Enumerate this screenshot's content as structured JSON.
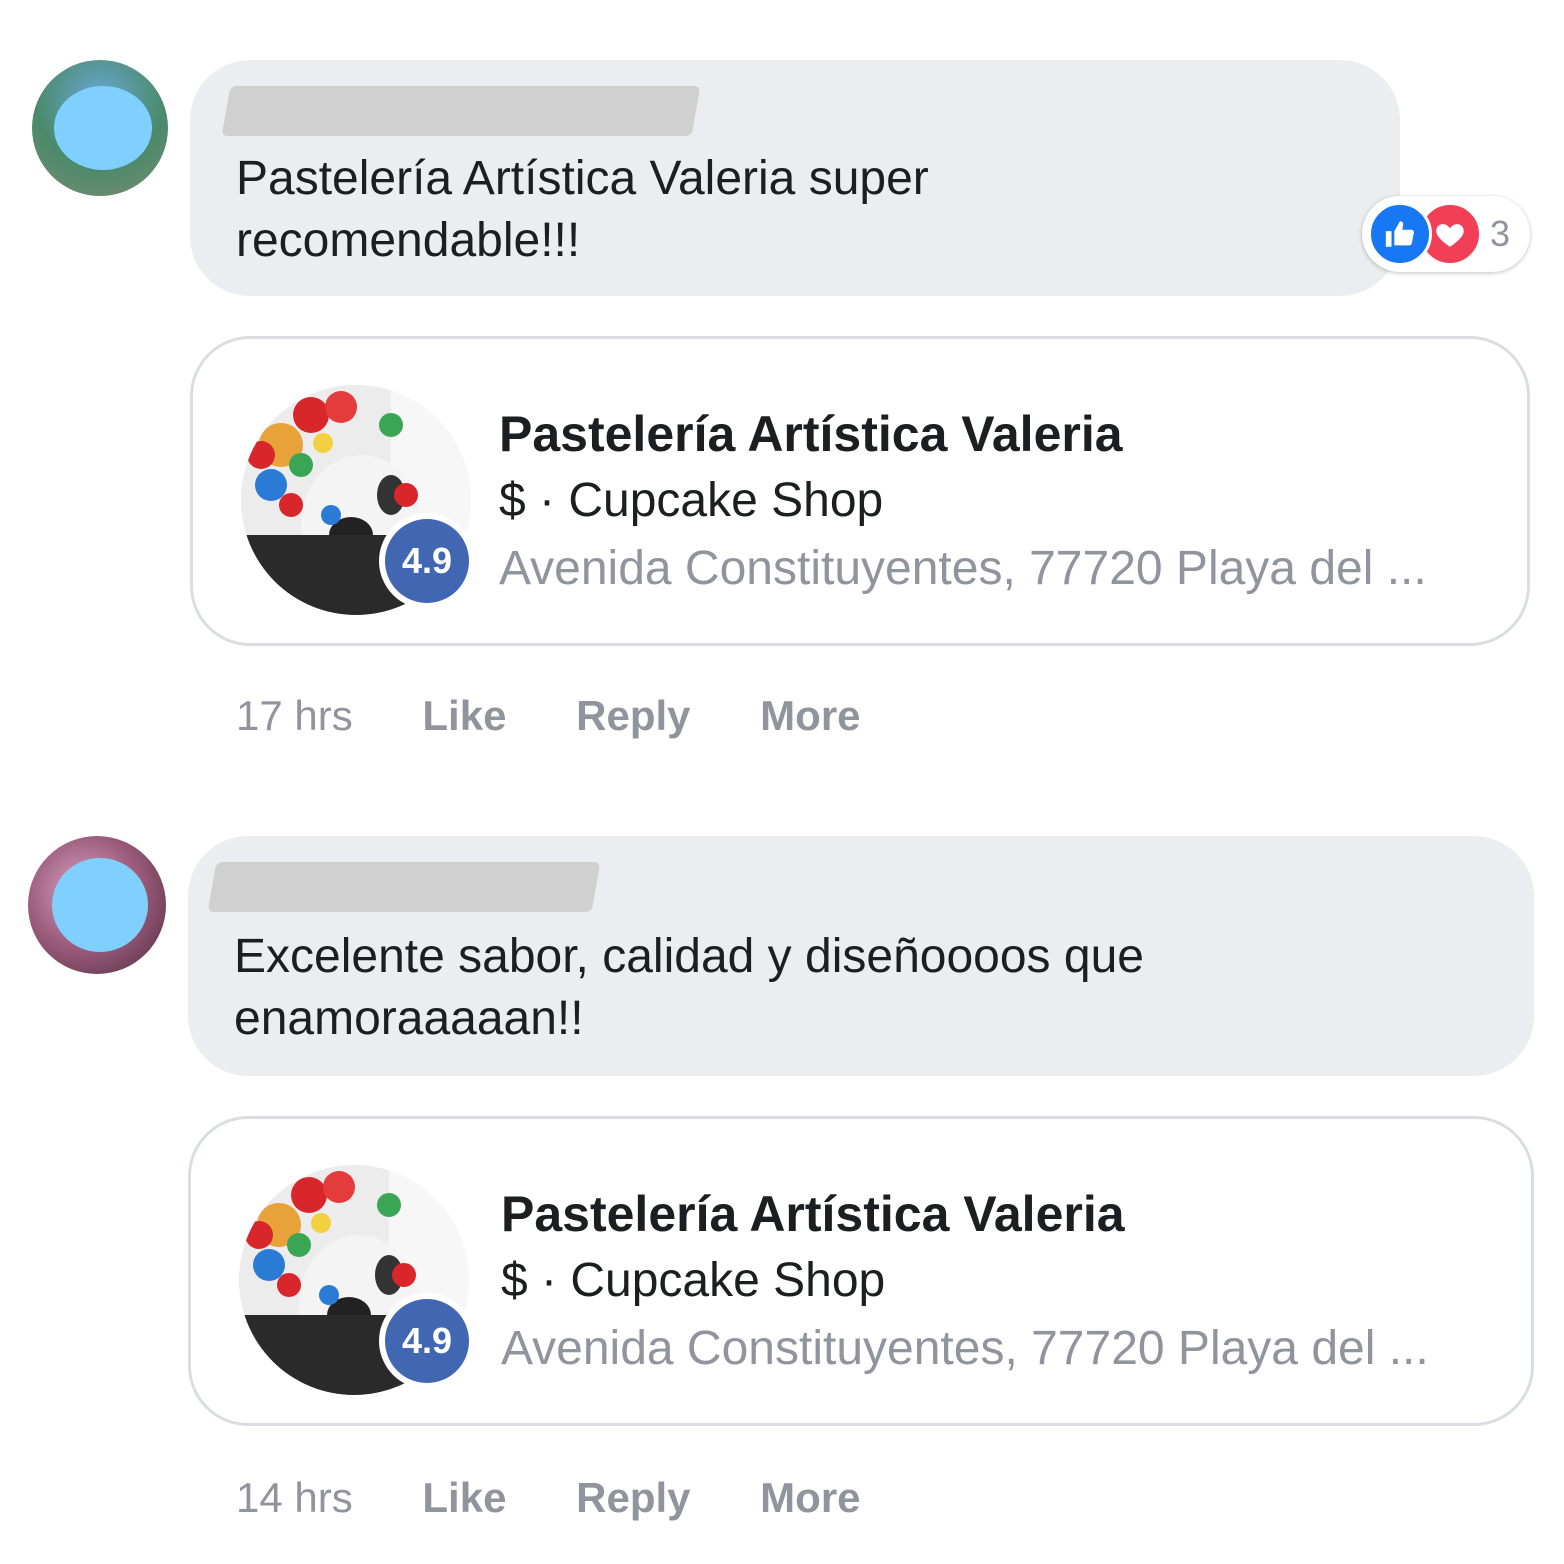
{
  "comments": [
    {
      "text_line1": "Pastelería Artística Valeria super",
      "text_line2": "recomendable!!!",
      "reaction_count": "3",
      "card": {
        "title": "Pastelería Artística Valeria",
        "subtitle": "$ · Cupcake Shop",
        "address": "Avenida Constituyentes, 77720 Playa del ...",
        "rating": "4.9"
      },
      "time": "17 hrs",
      "like_label": "Like",
      "reply_label": "Reply",
      "more_label": "More"
    },
    {
      "text_line1": "Excelente sabor, calidad y diseñoooos que",
      "text_line2": "enamoraaaaan!!",
      "card": {
        "title": "Pastelería Artística Valeria",
        "subtitle": "$ · Cupcake Shop",
        "address": "Avenida Constituyentes, 77720 Playa del ...",
        "rating": "4.9"
      },
      "time": "14 hrs",
      "like_label": "Like",
      "reply_label": "Reply",
      "more_label": "More"
    }
  ],
  "colors": {
    "bubble": "#ebedf0",
    "rating_badge": "#4267b2",
    "like_blue": "#1877f2",
    "love_red": "#f33e58",
    "meta_gray": "#90949c"
  }
}
